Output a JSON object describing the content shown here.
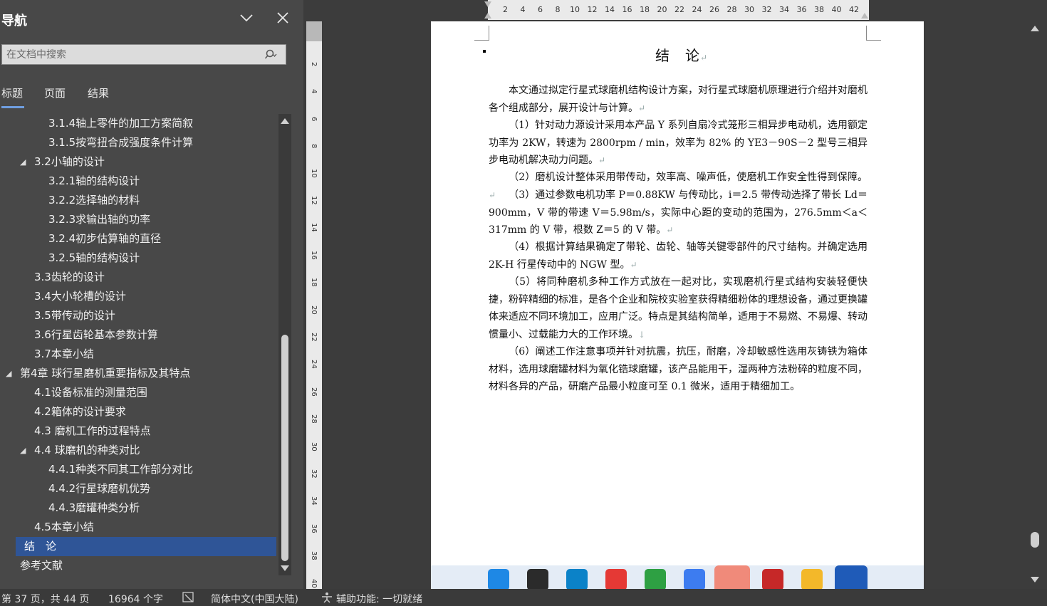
{
  "nav": {
    "title": "导航",
    "search_placeholder": "在文档中搜索",
    "tabs": [
      "标题",
      "页面",
      "结果"
    ],
    "items": [
      {
        "label": "3.1.4轴上零件的加工方案简叙",
        "level": 3,
        "expand": "none",
        "selected": false
      },
      {
        "label": "3.1.5按弯扭合成强度条件计算",
        "level": 3,
        "expand": "none",
        "selected": false
      },
      {
        "label": "3.2小轴的设计",
        "level": 2,
        "expand": "open",
        "selected": false
      },
      {
        "label": "3.2.1轴的结构设计",
        "level": 3,
        "expand": "none",
        "selected": false
      },
      {
        "label": "3.2.2选择轴的材料",
        "level": 3,
        "expand": "none",
        "selected": false
      },
      {
        "label": "3.2.3求输出轴的功率",
        "level": 3,
        "expand": "none",
        "selected": false
      },
      {
        "label": "3.2.4初步估算轴的直径",
        "level": 3,
        "expand": "none",
        "selected": false
      },
      {
        "label": "3.2.5轴的结构设计",
        "level": 3,
        "expand": "none",
        "selected": false
      },
      {
        "label": "3.3齿轮的设计",
        "level": 2,
        "expand": "none",
        "selected": false
      },
      {
        "label": "3.4大小轮槽的设计",
        "level": 2,
        "expand": "none",
        "selected": false
      },
      {
        "label": "3.5带传动的设计",
        "level": 2,
        "expand": "none",
        "selected": false
      },
      {
        "label": "3.6行星齿轮基本参数计算",
        "level": 2,
        "expand": "none",
        "selected": false
      },
      {
        "label": "3.7本章小结",
        "level": 2,
        "expand": "none",
        "selected": false
      },
      {
        "label": "第4章 球行星磨机重要指标及其特点",
        "level": 1,
        "expand": "open",
        "selected": false
      },
      {
        "label": "4.1设备标准的测量范围",
        "level": 2,
        "expand": "none",
        "selected": false
      },
      {
        "label": "4.2箱体的设计要求",
        "level": 2,
        "expand": "none",
        "selected": false
      },
      {
        "label": "4.3 磨机工作的过程特点",
        "level": 2,
        "expand": "none",
        "selected": false
      },
      {
        "label": "4.4 球磨机的种类对比",
        "level": 2,
        "expand": "open",
        "selected": false
      },
      {
        "label": "4.4.1种类不同其工作部分对比",
        "level": 3,
        "expand": "none",
        "selected": false
      },
      {
        "label": "4.4.2行星球磨机优势",
        "level": 3,
        "expand": "none",
        "selected": false
      },
      {
        "label": "4.4.3磨罐种类分析",
        "level": 3,
        "expand": "none",
        "selected": false
      },
      {
        "label": "4.5本章小结",
        "level": 2,
        "expand": "none",
        "selected": false
      },
      {
        "label": "结　论",
        "level": 1,
        "expand": "none",
        "selected": true
      },
      {
        "label": "参考文献",
        "level": 1,
        "expand": "none",
        "selected": false
      }
    ]
  },
  "ruler": {
    "h_labels": [
      "2",
      "4",
      "6",
      "8",
      "10",
      "12",
      "14",
      "16",
      "18",
      "20",
      "22",
      "24",
      "26",
      "28",
      "30",
      "32",
      "34",
      "36",
      "38",
      "40",
      "42"
    ],
    "v_labels": [
      "2",
      "4",
      "6",
      "8",
      "10",
      "12",
      "14",
      "16",
      "18",
      "20",
      "22",
      "24",
      "26",
      "28",
      "30",
      "32",
      "34",
      "36",
      "38",
      "40"
    ]
  },
  "document": {
    "title": "结　论",
    "paragraphs": [
      "本文通过拟定行星式球磨机结构设计方案，对行星式球磨机原理进行介绍并对磨机各个组成部分，展开设计与计算。",
      "（1）针对动力源设计采用本产品 Y 系列自扇冷式笼形三相异步电动机，选用额定功率为 2KW，转速为 2800rpm / min，效率为 82% 的 YE3－90S－2 型号三相异步电动机解决动力问题。",
      "（2）磨机设计整体采用带传动，效率高、噪声低，使磨机工作安全性得到保障。",
      "（3）通过参数电机功率 P＝0.88KW 与传动比，i＝2.5 带传动选择了带长 Ld＝900mm，V 带的带速 V＝5.98m/s，实际中心距的变动的范围为，276.5mm＜a＜317mm 的 V 带，根数 Z＝5 的 V 带。",
      "（4）根据计算结果确定了带轮、齿轮、轴等关键零部件的尺寸结构。并确定选用 2K-H 行星传动中的 NGW 型。",
      "（5）将同种磨机多种工作方式放在一起对比，实现磨机行星式结构安装轻便快捷，粉碎精细的标准，是各个企业和院校实验室获得精细粉体的理想设备，通过更换罐体来适应不同环境加工，应用广泛。特点是其结构简单，适用于不易燃、不易爆、转动惯量小、过载能力大的工作环境。",
      "（6）阐述工作注意事项并针对抗震，抗压，耐磨，冷却敏感性选用灰铸铁为箱体材料，选用球磨罐材料为氧化锆球磨罐，该产品能用干，湿两种方法粉碎的粒度不同，材料各异的产品，研磨产品最小粒度可至 0.1 微米，适用于精细加工。"
    ]
  },
  "taskbar": {
    "apps": [
      {
        "name": "windows-start",
        "color": "#1e88e5"
      },
      {
        "name": "app-dark",
        "color": "#2b2b2b"
      },
      {
        "name": "edge",
        "color": "#0b82c8"
      },
      {
        "name": "wps",
        "color": "#e53935"
      },
      {
        "name": "wechat",
        "color": "#2ea043"
      },
      {
        "name": "baidu-netdisk",
        "color": "#3d7cf0"
      },
      {
        "name": "chat-app",
        "color": "#f08a7a"
      },
      {
        "name": "autocad",
        "color": "#c62828"
      },
      {
        "name": "file-explorer",
        "color": "#f3b82a"
      },
      {
        "name": "word",
        "color": "#1f5bb8"
      }
    ]
  },
  "status": {
    "page": "第 37 页，共 44 页",
    "words": "16964 个字",
    "language": "简体中文(中国大陆)",
    "accessibility": "辅助功能: 一切就绪"
  }
}
